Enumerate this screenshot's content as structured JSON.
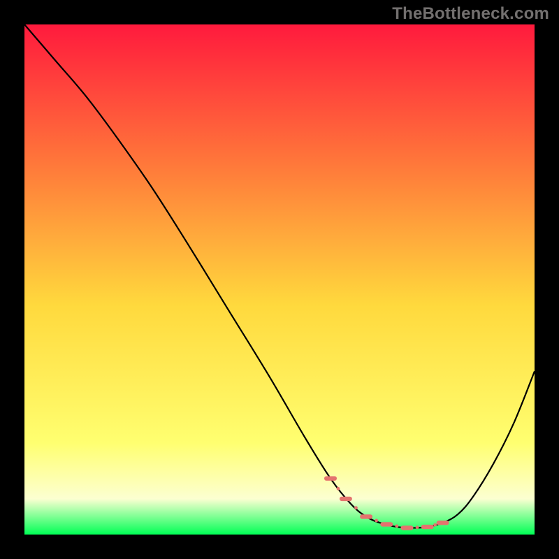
{
  "watermark": "TheBottleneck.com",
  "colors": {
    "gradient_top": "#ff1a3d",
    "gradient_mid1": "#ff7a3a",
    "gradient_mid2": "#ffd93d",
    "gradient_mid3": "#ffff70",
    "gradient_mid4": "#fcffd1",
    "gradient_bottom": "#00ff55",
    "curve": "#000000",
    "marker": "#e4736e",
    "background": "#000000"
  },
  "chart_data": {
    "type": "line",
    "title": "",
    "xlabel": "",
    "ylabel": "",
    "xlim": [
      0,
      100
    ],
    "ylim": [
      0,
      100
    ],
    "series": [
      {
        "name": "bottleneck-curve",
        "x": [
          0,
          6,
          12,
          18,
          25,
          32,
          40,
          48,
          55,
          60,
          64,
          67,
          70,
          73,
          76,
          79,
          82,
          85,
          88,
          92,
          96,
          100
        ],
        "y": [
          100,
          93,
          86,
          78,
          68,
          57,
          44,
          31,
          19,
          11,
          6,
          3.5,
          2.2,
          1.5,
          1.3,
          1.5,
          2.3,
          4,
          7.5,
          14,
          22,
          32
        ]
      }
    ],
    "markers": {
      "name": "valley-markers",
      "x": [
        60,
        63,
        67,
        71,
        75,
        79,
        82
      ],
      "y": [
        11,
        7,
        3.5,
        2,
        1.3,
        1.5,
        2.3
      ]
    }
  }
}
